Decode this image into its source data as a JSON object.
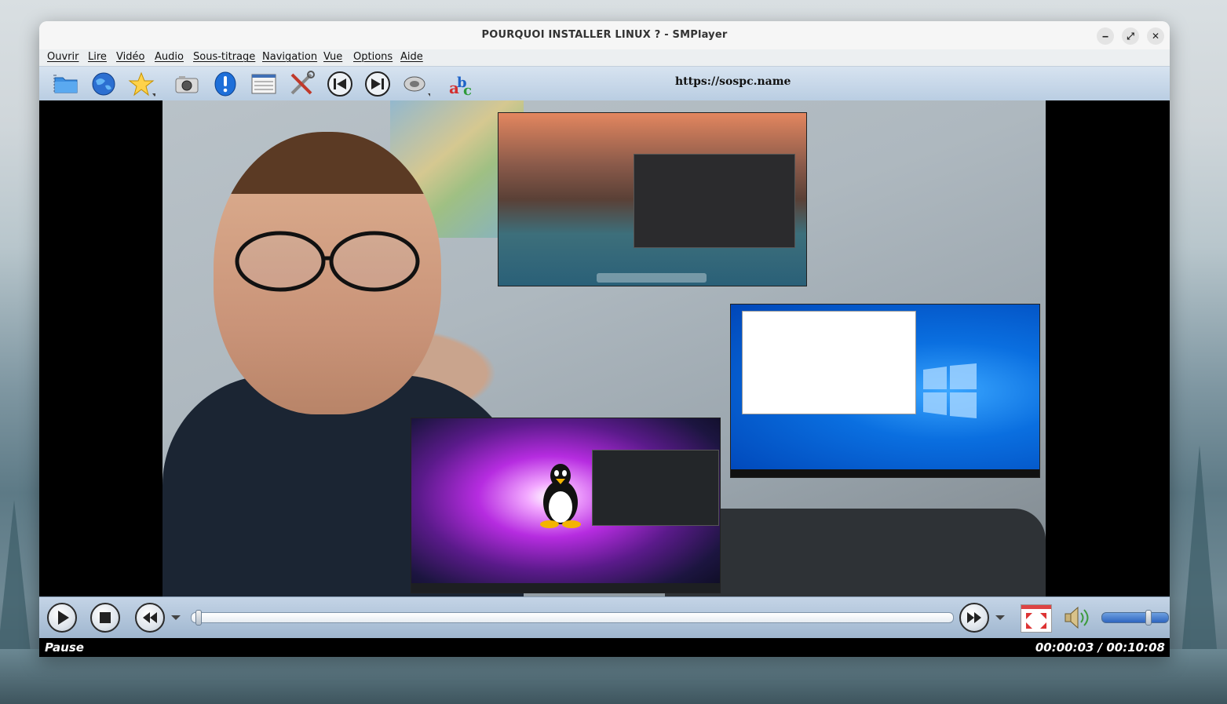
{
  "window": {
    "title": "POURQUOI INSTALLER LINUX ? - SMPlayer",
    "buttons": {
      "minimize": "‒",
      "maximize": "⤢",
      "close": "✕"
    }
  },
  "menubar": {
    "items": [
      "Ouvrir",
      "Lire",
      "Vidéo",
      "Audio",
      "Sous-titrage",
      "Navigation",
      "Vue",
      "Options",
      "Aide"
    ]
  },
  "toolbar": {
    "icons": [
      "folder-icon",
      "globe-icon",
      "favorites-star-icon",
      "screenshot-camera-icon",
      "info-icon",
      "playlist-icon",
      "preferences-tools-icon",
      "previous-icon",
      "next-icon",
      "audio-tracks-icon",
      "subtitles-abc-icon"
    ],
    "url_text": "https://sospc.name"
  },
  "video": {
    "description_icons": [
      "linux-tux-icon",
      "windows-logo-icon"
    ]
  },
  "controls": {
    "seek_position_fraction": 0.005,
    "volume_fraction": 0.73
  },
  "status": {
    "state": "Pause",
    "time": "00:00:03 / 00:10:08"
  },
  "colors": {
    "toolbar_gradient_top": "#d7e3f0",
    "toolbar_gradient_bottom": "#b9cde2",
    "status_bar": "#000000",
    "volume_fill": "#2f66c0"
  }
}
